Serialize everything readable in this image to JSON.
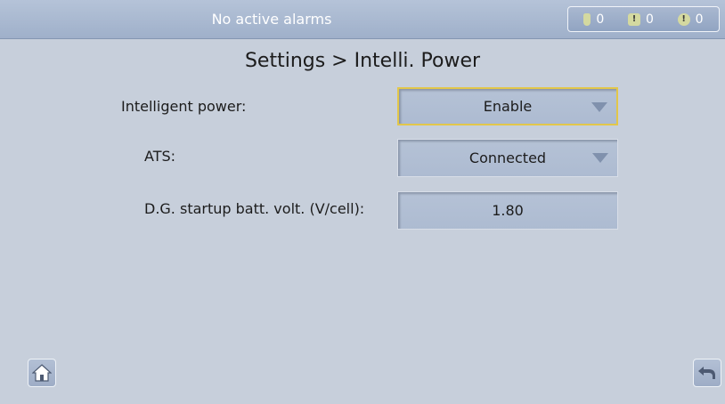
{
  "header": {
    "alarm_status": "No active alarms",
    "counters": [
      {
        "icon": "critical-alarm-icon",
        "value": "0"
      },
      {
        "icon": "major-alarm-icon",
        "value": "0"
      },
      {
        "icon": "minor-alarm-icon",
        "value": "0"
      }
    ]
  },
  "page": {
    "title": "Settings > Intelli. Power"
  },
  "settings": {
    "intelligent_power": {
      "label": "Intelligent power:",
      "value": "Enable"
    },
    "ats": {
      "label": "ATS:",
      "value": "Connected"
    },
    "dg_startup": {
      "label": "D.G. startup batt. volt. (V/cell):",
      "value": "1.80"
    }
  },
  "navigation": {
    "home_icon": "home-icon",
    "back_icon": "back-icon"
  },
  "colors": {
    "background": "#c7cfdb",
    "header": "#a9b8d0",
    "focus_border": "#e2c74a",
    "field": "#b0bed3"
  }
}
